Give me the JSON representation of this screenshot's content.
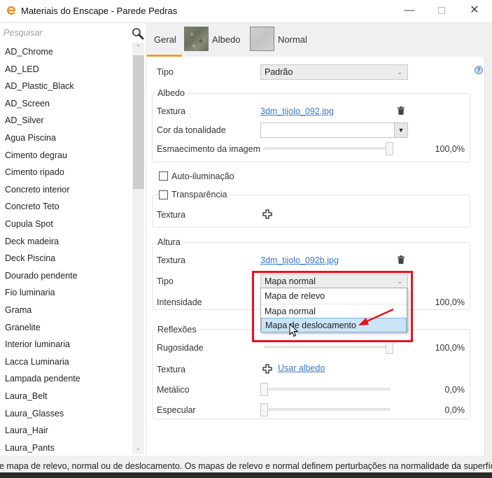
{
  "window": {
    "title": "Materiais do Enscape - Parede Pedras",
    "minimize": "—",
    "close": "✕"
  },
  "sidebar": {
    "search_placeholder": "Pesquisar",
    "items": [
      "AD_Chrome",
      "AD_LED",
      "AD_Plastic_Black",
      "AD_Screen",
      "AD_Silver",
      "Agua Piscina",
      "Cimento degrau",
      "Cimento ripado",
      "Concreto interior",
      "Concreto Teto",
      "Cupula Spot",
      "Deck madeira",
      "Deck Piscina",
      "Dourado pendente",
      "Fio luminaria",
      "Grama",
      "Granelite",
      "Interior luminaria",
      "Lacca Luminaria",
      "Lampada pendente",
      "Laura_Belt",
      "Laura_Glasses",
      "Laura_Hair",
      "Laura_Pants"
    ],
    "scroll_up": "^",
    "scroll_down": "v"
  },
  "tabs": [
    {
      "label": "Geral",
      "active": true
    },
    {
      "label": "Albedo",
      "active": false
    },
    {
      "label": "Normal",
      "active": false
    }
  ],
  "general": {
    "tipo_label": "Tipo",
    "tipo_value": "Padrão",
    "help": "?"
  },
  "albedo": {
    "title": "Albedo",
    "textura_label": "Textura",
    "textura_file": "3dm_tijolo_092.jpg",
    "cor_label": "Cor da tonalidade",
    "cor_value": "",
    "esmaecimento_label": "Esmaecimento da imagem",
    "esmaecimento_value": "100,0%",
    "esmaecimento_fraction": 1.0
  },
  "auto_iluminacao": {
    "label": "Auto-iluminação",
    "checked": false
  },
  "transparencia": {
    "label": "Transparência",
    "checked": false,
    "textura_label": "Textura"
  },
  "altura": {
    "title": "Altura",
    "textura_label": "Textura",
    "textura_file": "3dm_tijolo_092b.jpg",
    "tipo_label": "Tipo",
    "tipo_value": "Mapa normal",
    "intensidade_label": "Intensidade",
    "intensidade_value": "100,0%",
    "dropdown_options": [
      "Mapa de relevo",
      "Mapa normal",
      "Mapa de deslocamento"
    ],
    "dropdown_hovered": "Mapa de deslocamento"
  },
  "reflexoes": {
    "title": "Reflexões",
    "rugosidade_label": "Rugosidade",
    "rugosidade_value": "100,0%",
    "rugosidade_fraction": 1.0,
    "textura_label": "Textura",
    "usar_albedo": "Usar albedo",
    "metalico_label": "Metálico",
    "metalico_value": "0,0%",
    "metalico_fraction": 0.0,
    "especular_label": "Especular",
    "especular_value": "0,0%",
    "especular_fraction": 0.0
  },
  "status": {
    "text": "e mapa de relevo, normal ou de deslocamento. Os mapas de relevo e normal definem perturbações na normalidade da superfície. O"
  },
  "colors": {
    "accent_tab": "#e5a23a",
    "link": "#3a78c8",
    "annotation_red": "#e8121b",
    "hover_option": "#cce4f7"
  }
}
